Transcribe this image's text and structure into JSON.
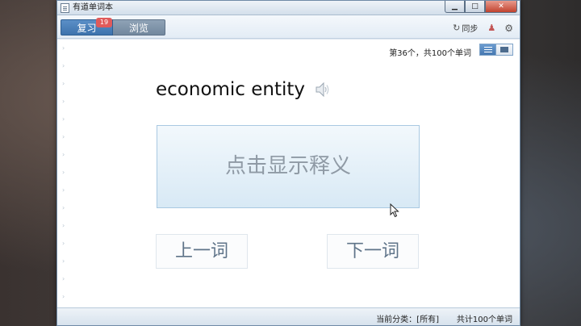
{
  "window": {
    "title": "有道单词本",
    "close_glyph": "✕",
    "min_glyph": "▁",
    "max_glyph": "□"
  },
  "toolbar": {
    "tabs": [
      {
        "label": "复习",
        "badge": "19"
      },
      {
        "label": "浏览"
      }
    ],
    "sync_label": "同步"
  },
  "card": {
    "progress": "第36个，共100个单词",
    "word": "economic entity",
    "reveal_label": "点击显示释义",
    "prev_label": "上一词",
    "next_label": "下一词"
  },
  "status": {
    "category": "当前分类：[所有]",
    "total": "共计100个单词"
  },
  "colors": {
    "accent": "#4678b1",
    "badge": "#e05a5a",
    "reveal_bg": "#d8e9f5"
  },
  "icons": [
    "app-icon",
    "sync-icon",
    "user-icon",
    "gear-icon",
    "list-view-icon",
    "card-view-icon",
    "speaker-icon"
  ]
}
